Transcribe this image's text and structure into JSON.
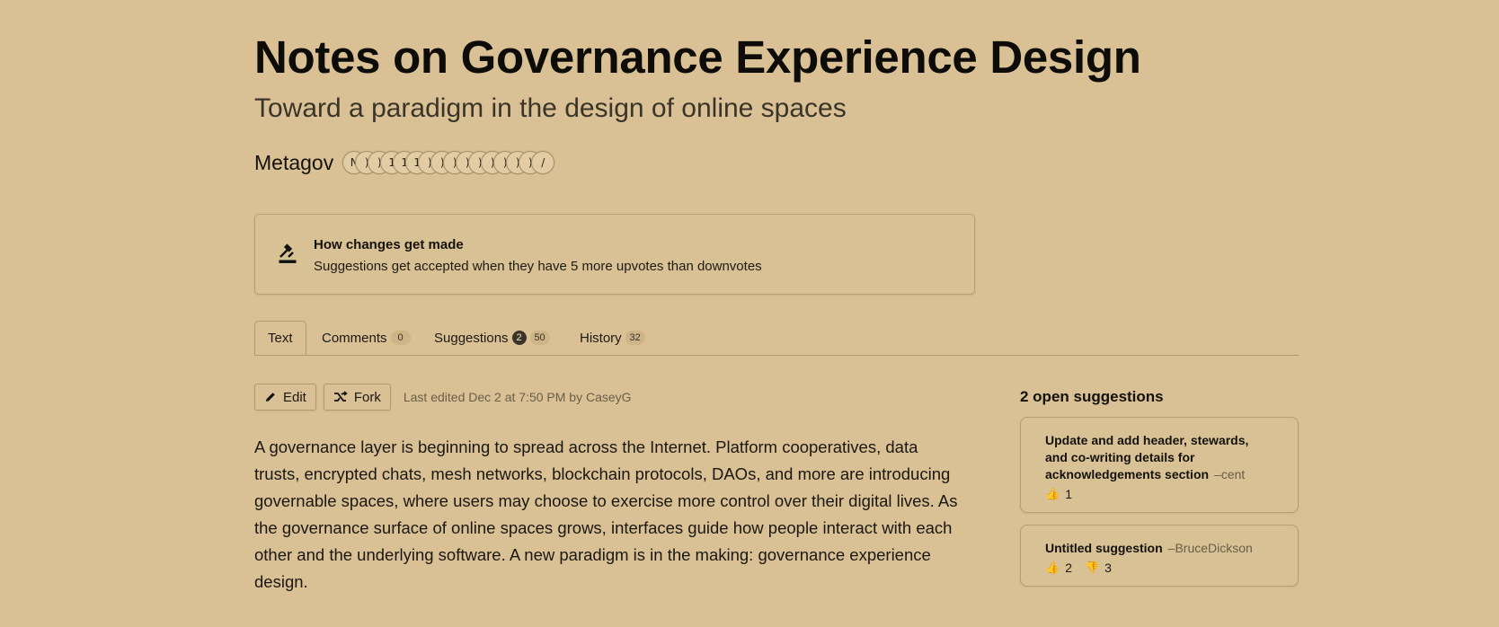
{
  "document": {
    "title": "Notes on Governance Experience Design",
    "subtitle": "Toward a paradigm in the design of online spaces",
    "author": "Metagov",
    "contributor_initials": [
      "N",
      ")",
      ")",
      "1",
      "1",
      "1",
      ")",
      ")",
      ")",
      ")",
      ")",
      ")",
      ")",
      ")",
      ")",
      "/"
    ]
  },
  "rules": {
    "icon": "gavel-icon",
    "heading": "How changes get made",
    "text": "Suggestions get accepted when they have 5 more upvotes than downvotes"
  },
  "tabs": [
    {
      "label": "Text",
      "count": ""
    },
    {
      "label": "Comments",
      "count": "0"
    },
    {
      "label": "Suggestions",
      "badge": "2",
      "count": "50"
    },
    {
      "label": "History",
      "count": "32"
    }
  ],
  "toolbar": {
    "edit_label": "Edit",
    "fork_label": "Fork",
    "last_edited": "Last edited Dec 2 at 7:50 PM by CaseyG"
  },
  "body": {
    "paragraph": "A governance layer is beginning to spread across the Internet. Platform cooperatives, data trusts, encrypted chats, mesh networks, blockchain protocols, DAOs, and more are introducing governable spaces, where users may choose to exercise more control over their digital lives. As the governance surface of online spaces grows, interfaces guide how people interact with each other and the underlying software. A new paradigm is in the making: governance experience design."
  },
  "sidebar": {
    "title": "2 open suggestions",
    "suggestions": [
      {
        "title": "Update and add header, stewards, and co-writing details for acknowledgements section",
        "author": "–cent",
        "upvotes": "1",
        "downvotes": ""
      },
      {
        "title": "Untitled suggestion",
        "author": "–BruceDickson",
        "upvotes": "2",
        "downvotes": "3"
      }
    ]
  },
  "colors": {
    "background": "#d9c195",
    "border": "#b89e70",
    "muted_text": "#6a5e4a",
    "thumb": "#e6b52a"
  }
}
